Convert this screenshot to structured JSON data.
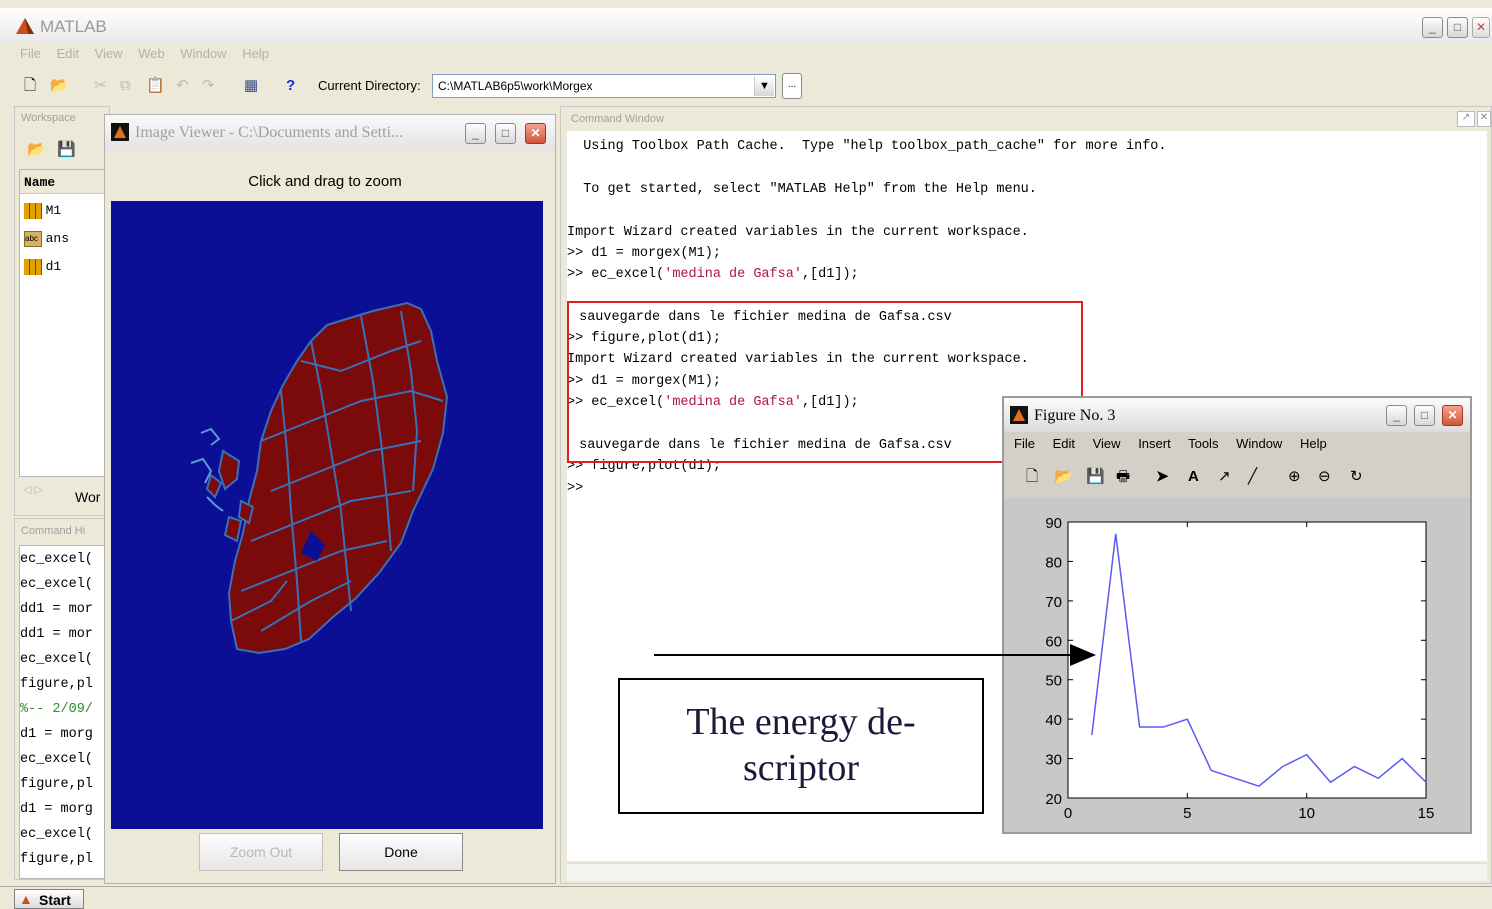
{
  "app": {
    "title": "MATLAB"
  },
  "menu": [
    "File",
    "Edit",
    "View",
    "Web",
    "Window",
    "Help"
  ],
  "toolbar": {
    "current_dir_label": "Current Directory:",
    "current_dir_value": "C:\\MATLAB6p5\\work\\Morgex",
    "browse_label": "...",
    "help_glyph": "?"
  },
  "workspace": {
    "title": "Workspace",
    "column": "Name",
    "items": [
      {
        "name": "M1",
        "icon": "matrix-icon"
      },
      {
        "name": "ans",
        "icon": "text-variable-icon"
      },
      {
        "name": "d1",
        "icon": "matrix-icon"
      }
    ],
    "tab_label": "Wor"
  },
  "image_viewer": {
    "title": "Image Viewer - C:\\Documents and Setti...",
    "hint": "Click and drag to zoom",
    "zoom_out_label": "Zoom Out",
    "done_label": "Done",
    "map_fill": "#7b0a0a",
    "map_background": "#0a0f96"
  },
  "command_history": {
    "title": "Command Hi",
    "lines": [
      "ec_excel(",
      "ec_excel(",
      "dd1 = mor",
      "dd1 = mor",
      "ec_excel(",
      "figure,pl",
      "%-- 2/09/",
      "d1 = morg",
      "ec_excel(",
      "figure,pl",
      "d1 = morg",
      "ec_excel(",
      "figure,pl"
    ]
  },
  "command_window": {
    "title": "Command Window",
    "line1": "  Using Toolbox Path Cache.  Type \"help toolbox_path_cache\" for more info.",
    "line2": "  To get started, select \"MATLAB Help\" from the Help menu.",
    "line3": "Import Wizard created variables in the current workspace.",
    "line4": ">> d1 = morgex(M1);",
    "line5a": ">> ec_excel(",
    "line5b": "'medina de Gafsa'",
    "line5c": ",[d1]);",
    "line6": " sauvegarde dans le fichier medina de Gafsa.csv",
    "line7": ">> figure,plot(d1);",
    "line8": "Import Wizard created variables in the current workspace.",
    "line9": ">> d1 = morgex(M1);",
    "line10a": ">> ec_excel(",
    "line10b": "'medina de Gafsa'",
    "line10c": ",[d1]);",
    "line11": " sauvegarde dans le fichier medina de Gafsa.csv",
    "line12": ">> figure,plot(d1);",
    "line13": ">>"
  },
  "figure": {
    "title": "Figure No. 3",
    "menu": [
      "File",
      "Edit",
      "View",
      "Insert",
      "Tools",
      "Window",
      "Help"
    ]
  },
  "annotation": {
    "text_line1": "The energy de-",
    "text_line2": "scriptor"
  },
  "taskbar": {
    "start_label": "Start"
  },
  "chart_data": {
    "type": "line",
    "x": [
      1,
      2,
      3,
      4,
      5,
      6,
      7,
      8,
      9,
      10,
      11,
      12,
      13,
      14,
      15
    ],
    "values": [
      36,
      87,
      38,
      38,
      40,
      27,
      25,
      23,
      28,
      31,
      24,
      28,
      25,
      30,
      24
    ],
    "xlim": [
      0,
      15
    ],
    "ylim": [
      20,
      90
    ],
    "xticks": [
      0,
      5,
      10,
      15
    ],
    "yticks": [
      20,
      30,
      40,
      50,
      60,
      70,
      80,
      90
    ],
    "line_color": "#5a5af0"
  }
}
